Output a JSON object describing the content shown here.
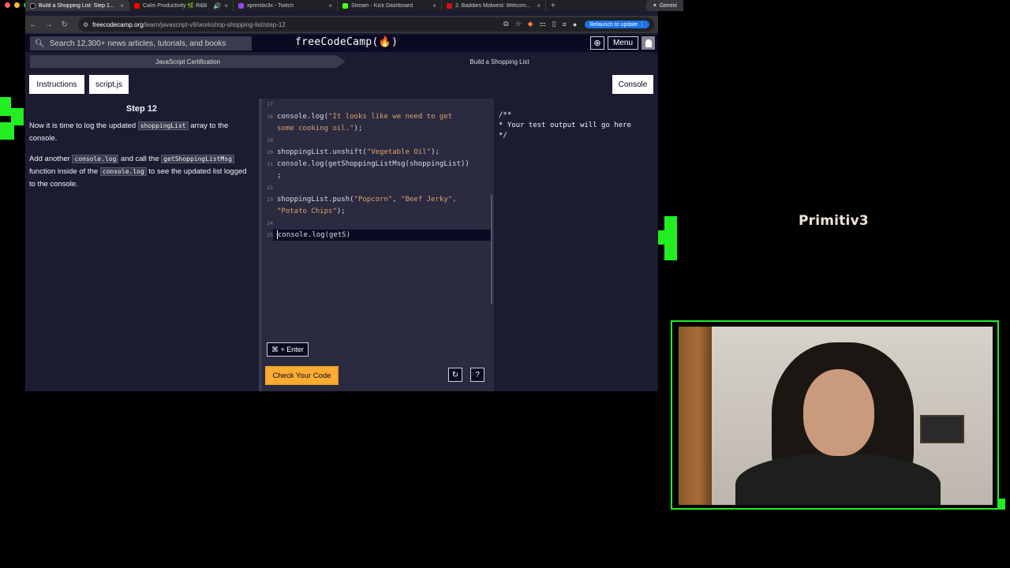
{
  "browser": {
    "tabs": [
      {
        "title": "Build a Shopping List: Step 1...",
        "favicon_color": "#0a0a23",
        "active": true
      },
      {
        "title": "Calm Productivity 🌿 R&B",
        "favicon_color": "#ff0000",
        "active": false
      },
      {
        "title": "xprimitiv3x - Twitch",
        "favicon_color": "#9146ff",
        "active": false
      },
      {
        "title": "Stream - Kick Dashboard",
        "favicon_color": "#53fc18",
        "active": false
      },
      {
        "title": "2. Baddies Midwest: Welcom...",
        "favicon_color": "#e50914",
        "active": false
      }
    ],
    "gemini_label": "Gemini",
    "url_host": "freecodecamp.org",
    "url_path": "/learn/javascript-v9/workshop-shopping-list/step-12",
    "relaunch_label": "Relaunch to update"
  },
  "fcc": {
    "search_placeholder": "Search 12,300+ news articles, tutorials, and books",
    "logo": "freeCodeCamp(🔥)",
    "menu_label": "Menu",
    "breadcrumb": {
      "left": "JavaScript Certification",
      "right": "Build a Shopping List"
    },
    "tabs": {
      "instructions": "Instructions",
      "script": "script.js",
      "console": "Console"
    },
    "step_title": "Step 12",
    "instructions": {
      "p1_a": "Now it is time to log the updated ",
      "p1_code": "shoppingList",
      "p1_b": " array to the console.",
      "p2_a": "Add another ",
      "p2_code1": "console.log",
      "p2_b": " and call the ",
      "p2_code2": "getShoppingListMsg",
      "p2_c": " function inside of the ",
      "p2_code3": "console.log",
      "p2_d": " to see the updated list logged to the console."
    },
    "code_lines": [
      {
        "n": "17",
        "text": ""
      },
      {
        "n": "18",
        "pre": "console.log(",
        "str": "\"It looks like we need to get",
        "post": ""
      },
      {
        "n": "",
        "pre": "",
        "str": "some cooking oil.\"",
        "post": ");"
      },
      {
        "n": "19",
        "text": ""
      },
      {
        "n": "20",
        "pre": "shoppingList.unshift(",
        "str": "\"Vegetable Oil\"",
        "post": ");"
      },
      {
        "n": "21",
        "pre": "console.log(getShoppingListMsg(shoppingList))",
        "str": "",
        "post": ""
      },
      {
        "n": "",
        "pre": ";",
        "str": "",
        "post": ""
      },
      {
        "n": "22",
        "text": ""
      },
      {
        "n": "23",
        "pre": "shoppingList.push(",
        "str": "\"Popcorn\"",
        "post": ", "
      },
      {
        "n": "",
        "pre": "",
        "str": "\"Potato Chips\"",
        "post": ");"
      },
      {
        "n": "24",
        "text": ""
      },
      {
        "n": "25",
        "pre": "console.log(getS)",
        "str": "",
        "post": ""
      }
    ],
    "line23_rest": "\"Beef Jerky\",",
    "kbd_hint": "⌘ + Enter",
    "check_button": "Check Your Code",
    "console_output": "/**\n* Your test output will go here\n*/"
  },
  "stream": {
    "title": "Primitiv3",
    "accent_color": "#22ee22"
  }
}
